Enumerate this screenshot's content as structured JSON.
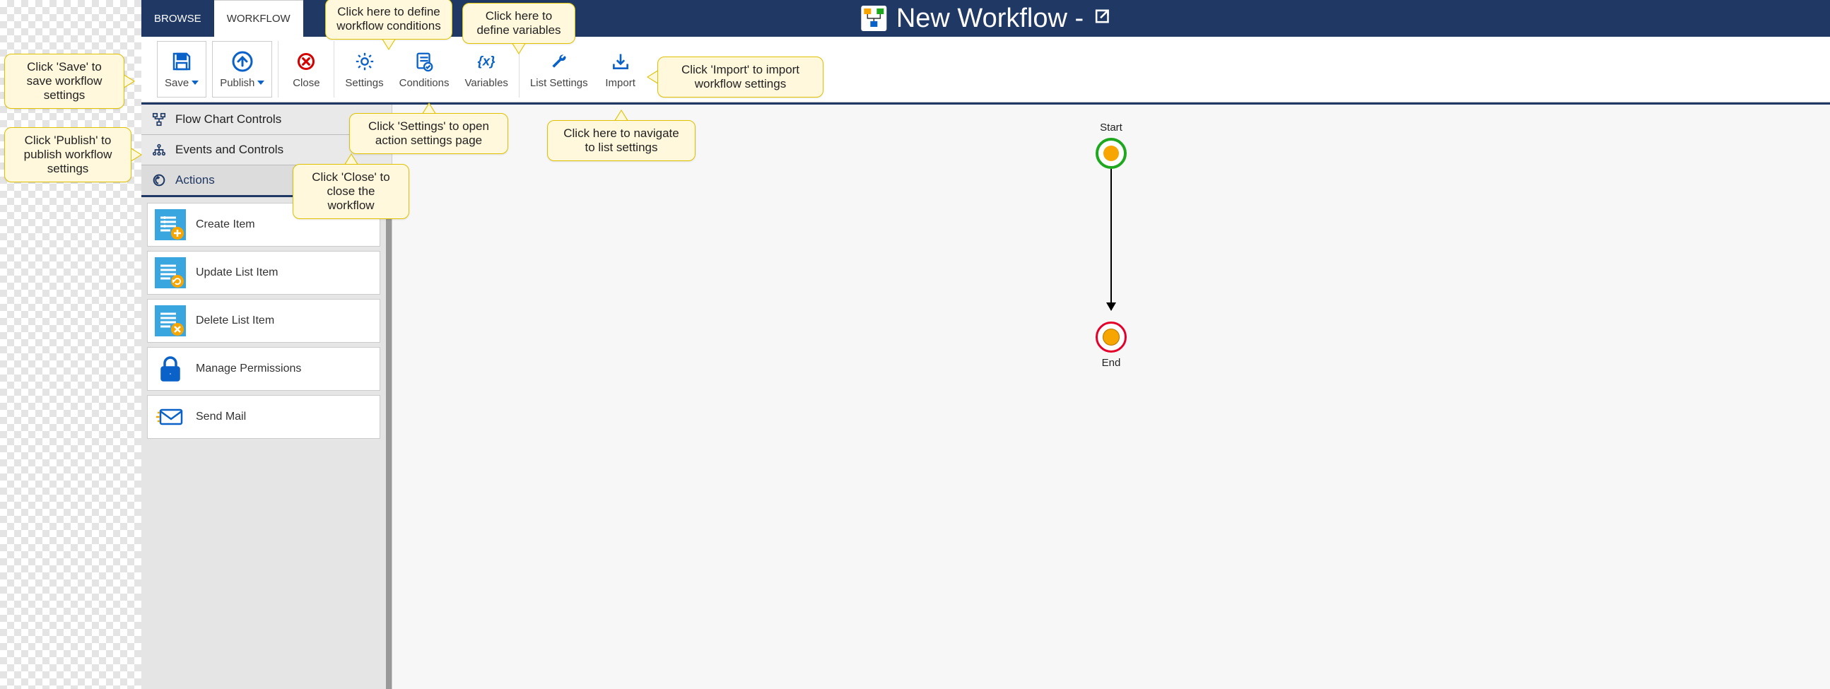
{
  "header": {
    "tabs": {
      "browse": "BROWSE",
      "workflow": "WORKFLOW"
    },
    "title": "New Workflow -"
  },
  "ribbon": {
    "save": "Save",
    "publish": "Publish",
    "close": "Close",
    "settings": "Settings",
    "conditions": "Conditions",
    "variables": "Variables",
    "list_settings": "List Settings",
    "import": "Import"
  },
  "sidebar": {
    "flow_chart": "Flow Chart Controls",
    "events": "Events and Controls",
    "actions": "Actions",
    "items": {
      "create": "Create Item",
      "update": "Update List Item",
      "delete": "Delete List Item",
      "perms": "Manage Permissions",
      "mail": "Send Mail"
    }
  },
  "canvas": {
    "start": "Start",
    "end": "End"
  },
  "callouts": {
    "save": "Click 'Save' to save workflow settings",
    "publish": "Click 'Publish' to publish workflow settings",
    "conditions": "Click here to define workflow conditions",
    "variables": "Click here to define variables",
    "import": "Click 'Import' to import workflow settings",
    "settings": "Click 'Settings' to open action settings page",
    "list_settings": "Click here to navigate to list settings",
    "close": "Click 'Close' to close the workflow"
  }
}
